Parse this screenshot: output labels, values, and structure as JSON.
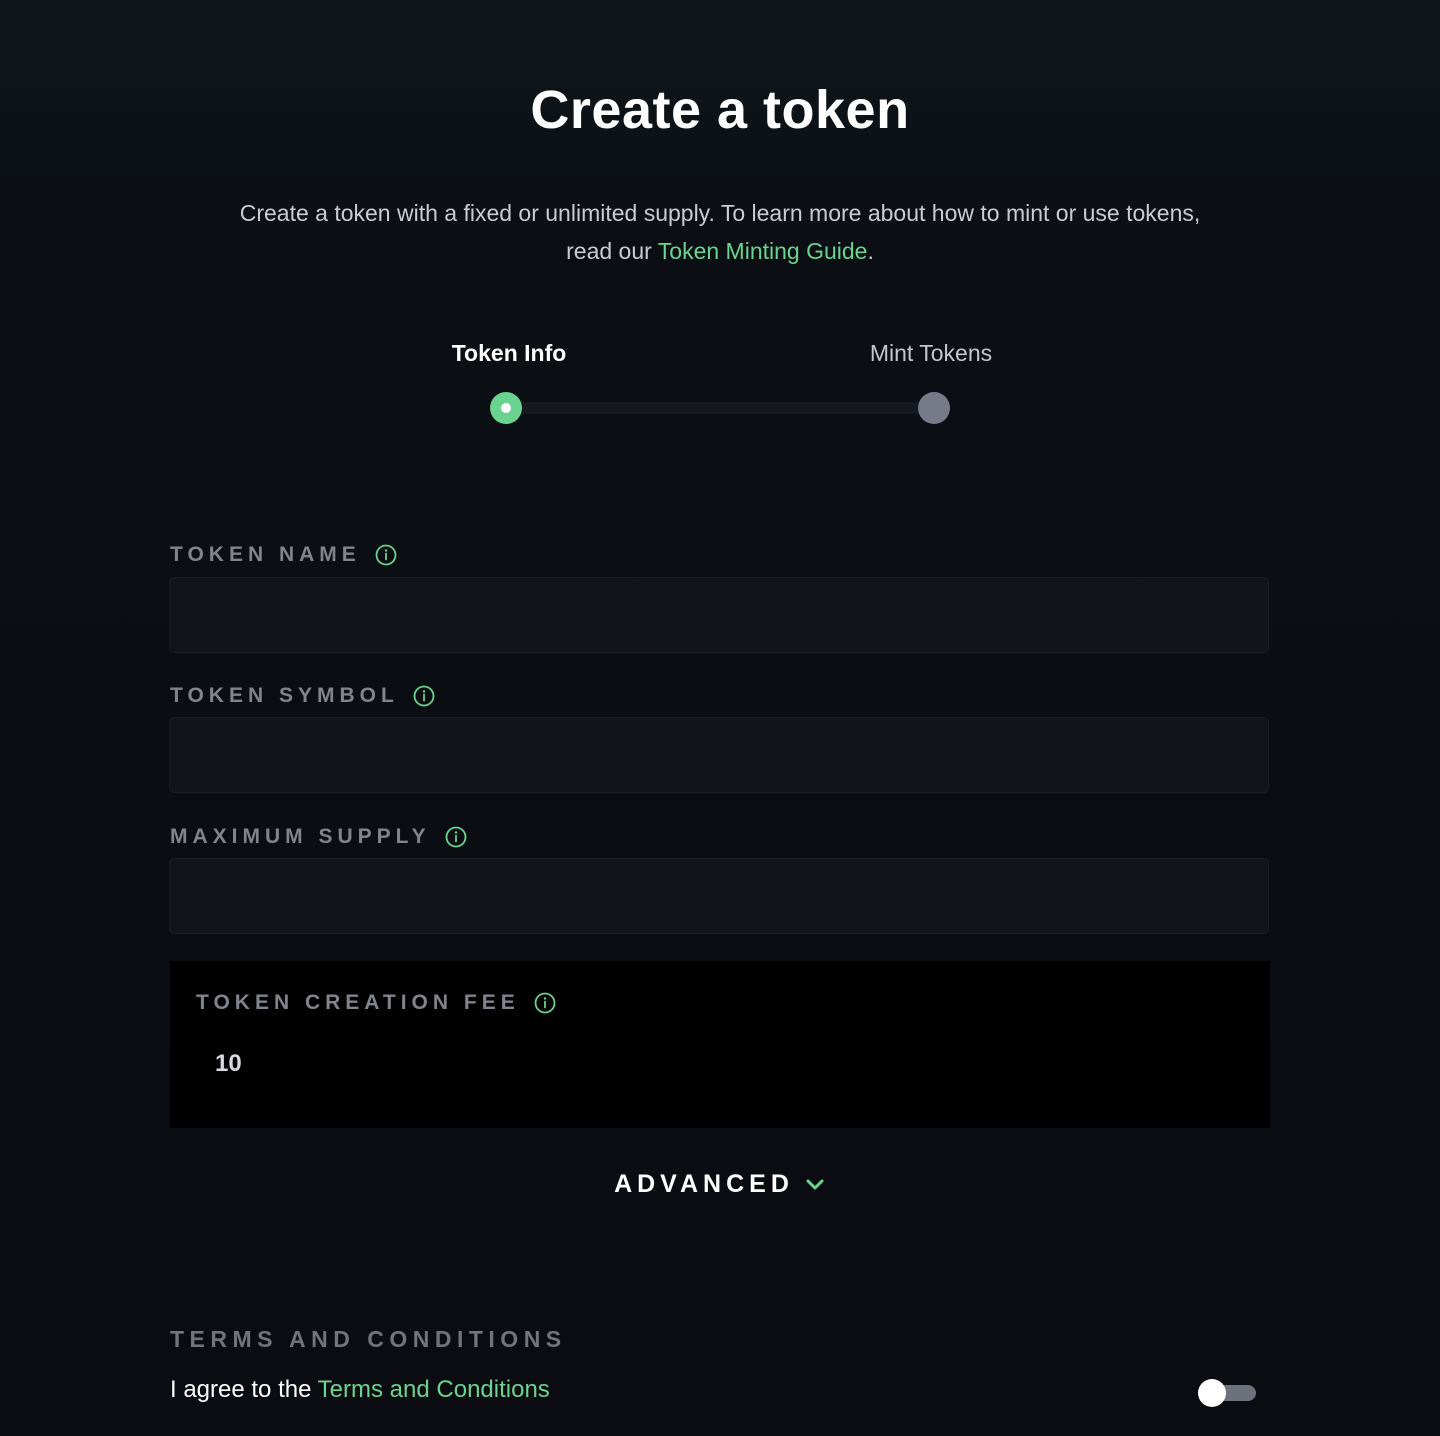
{
  "page": {
    "title": "Create a token",
    "subtitle_text": "Create a token with a fixed or unlimited supply. To learn more about how to mint or use tokens, read our",
    "subtitle_link": "Token Minting Guide",
    "subtitle_end": "."
  },
  "stepper": {
    "steps": [
      {
        "label": "Token Info",
        "state": "active"
      },
      {
        "label": "Mint Tokens",
        "state": "inactive"
      }
    ]
  },
  "form": {
    "token_name": {
      "label": "TOKEN NAME",
      "value": "",
      "placeholder": ""
    },
    "token_symbol": {
      "label": "TOKEN SYMBOL",
      "value": "",
      "placeholder": ""
    },
    "maximum_supply": {
      "label": "MAXIMUM SUPPLY",
      "value": "",
      "placeholder": ""
    },
    "creation_fee": {
      "label": "TOKEN CREATION FEE",
      "value": "10"
    }
  },
  "advanced": {
    "label": "ADVANCED"
  },
  "terms": {
    "heading": "TERMS AND CONDITIONS",
    "text": "I agree to the",
    "link": "Terms and Conditions",
    "agreed": false
  },
  "colors": {
    "accent": "#6ad38f",
    "background": "#0a0c11",
    "input_bg": "#12131b",
    "label": "#7f848d"
  },
  "icons": {
    "info": "info-circle-icon",
    "chevron": "chevron-down-icon"
  }
}
